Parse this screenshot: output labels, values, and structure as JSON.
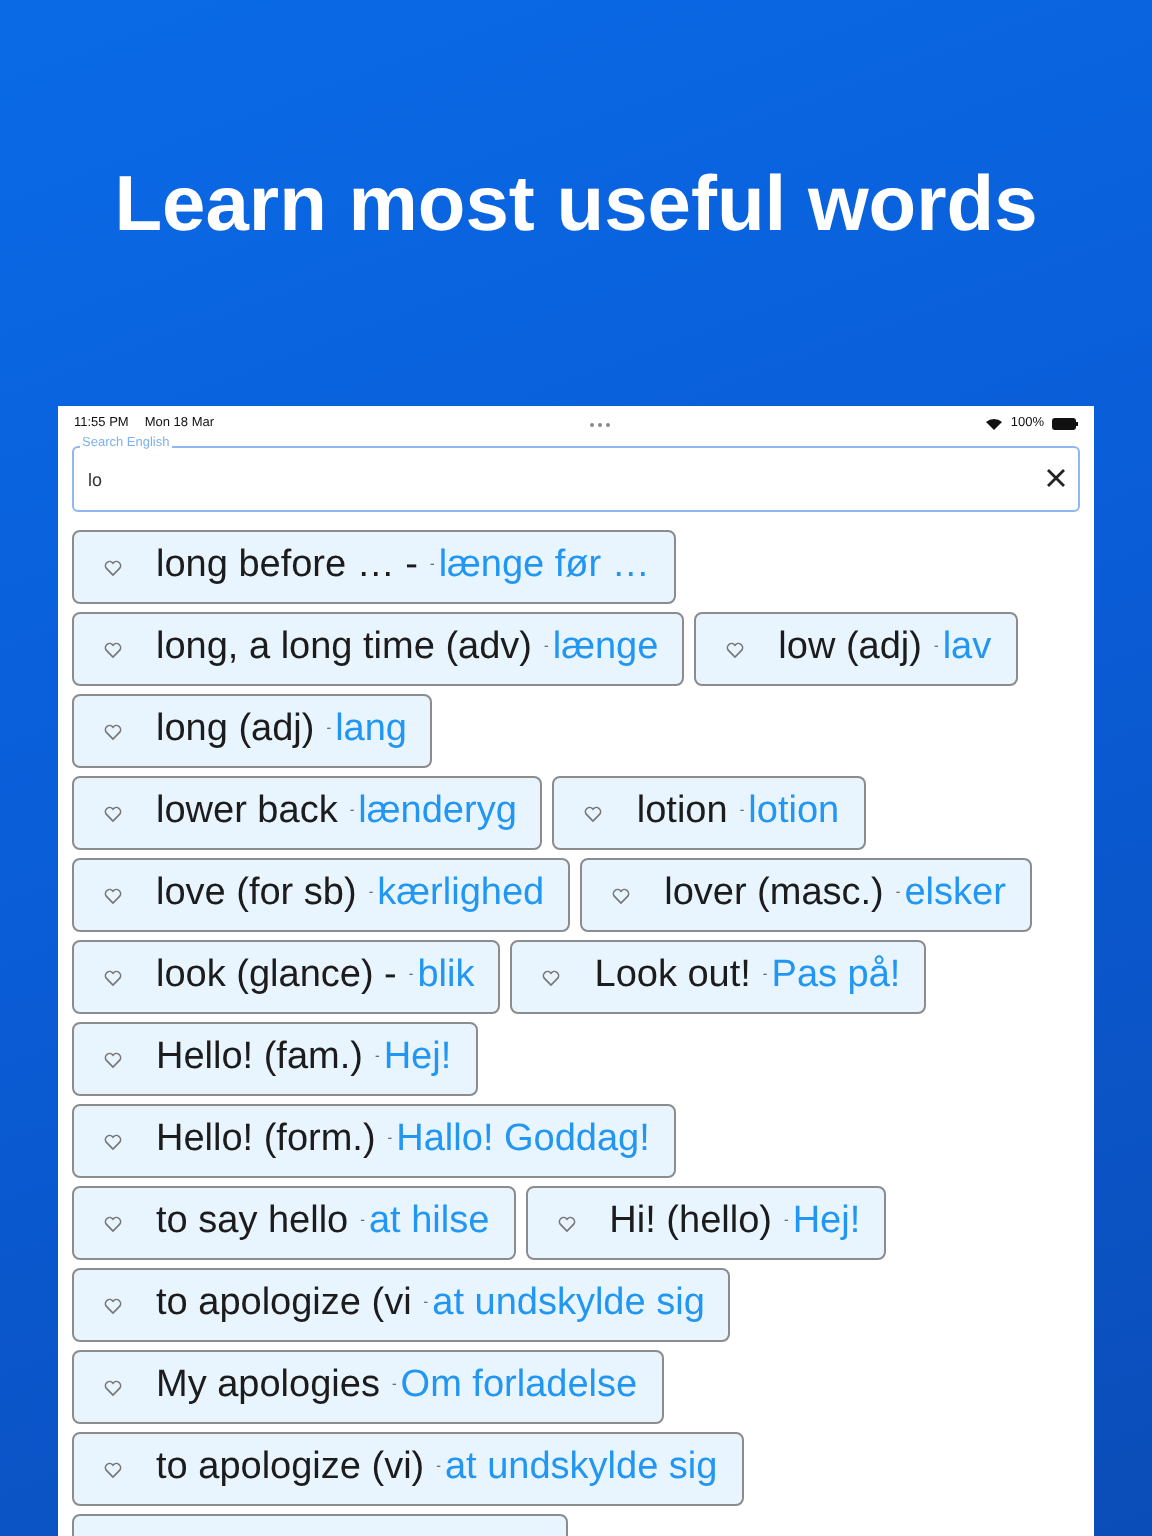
{
  "headline": "Learn most useful words",
  "status_bar": {
    "time": "11:55 PM",
    "date": "Mon 18 Mar",
    "battery": "100%"
  },
  "search": {
    "label": "Search English",
    "value": "lo"
  },
  "rows": [
    [
      {
        "english": "long before … -",
        "separator": "-",
        "danish": "længe før …"
      }
    ],
    [
      {
        "english": "long, a long time (adv)",
        "separator": "-",
        "danish": "længe"
      },
      {
        "english": "low (adj)",
        "separator": "-",
        "danish": "lav"
      }
    ],
    [
      {
        "english": "long (adj)",
        "separator": "-",
        "danish": "lang"
      }
    ],
    [
      {
        "english": "lower back",
        "separator": "-",
        "danish": "lænderyg"
      },
      {
        "english": "lotion",
        "separator": "-",
        "danish": "lotion"
      }
    ],
    [
      {
        "english": "love (for sb)",
        "separator": "-",
        "danish": "kærlighed"
      },
      {
        "english": "lover (masc.)",
        "separator": "-",
        "danish": "elsker"
      }
    ],
    [
      {
        "english": "look (glance) -",
        "separator": "-",
        "danish": "blik"
      },
      {
        "english": "Look out!",
        "separator": "-",
        "danish": "Pas på!"
      }
    ],
    [
      {
        "english": "Hello! (fam.)",
        "separator": "-",
        "danish": "Hej!"
      }
    ],
    [
      {
        "english": "Hello! (form.)",
        "separator": "-",
        "danish": "Hallo! Goddag!"
      }
    ],
    [
      {
        "english": "to say hello",
        "separator": "-",
        "danish": "at hilse"
      },
      {
        "english": "Hi! (hello)",
        "separator": "-",
        "danish": "Hej!"
      }
    ],
    [
      {
        "english": "to apologize (vi",
        "separator": "-",
        "danish": "at undskylde sig"
      }
    ],
    [
      {
        "english": "My apologies",
        "separator": "-",
        "danish": "Om forladelse"
      }
    ],
    [
      {
        "english": "to apologize (vi)",
        "separator": "-",
        "danish": "at undskylde sig"
      }
    ]
  ]
}
